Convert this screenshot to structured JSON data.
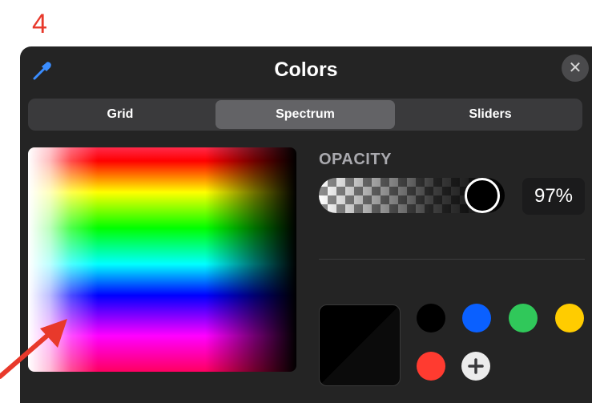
{
  "step": {
    "number": "4"
  },
  "header": {
    "title": "Colors",
    "eyedropper_icon": "eyedropper-icon",
    "close_icon": "close-icon",
    "close_symbol": "✕"
  },
  "tabs": [
    {
      "label": "Grid",
      "selected": false
    },
    {
      "label": "Spectrum",
      "selected": true
    },
    {
      "label": "Sliders",
      "selected": false
    }
  ],
  "opacity": {
    "label": "OPACITY",
    "value": "97%",
    "level": 0.97
  },
  "current_color": "#000000",
  "saved_colors": [
    {
      "name": "black",
      "hex": "#000000"
    },
    {
      "name": "blue",
      "hex": "#0a60ff"
    },
    {
      "name": "green",
      "hex": "#30c85a"
    },
    {
      "name": "yellow",
      "hex": "#ffcc00"
    },
    {
      "name": "red",
      "hex": "#ff3b30"
    }
  ],
  "add_color_icon": "plus-icon",
  "annotation_icon": "red-arrow-icon",
  "colors": {
    "accent_red": "#e8392b",
    "panel_bg": "#242424",
    "eyedropper_blue": "#3a8dff"
  }
}
